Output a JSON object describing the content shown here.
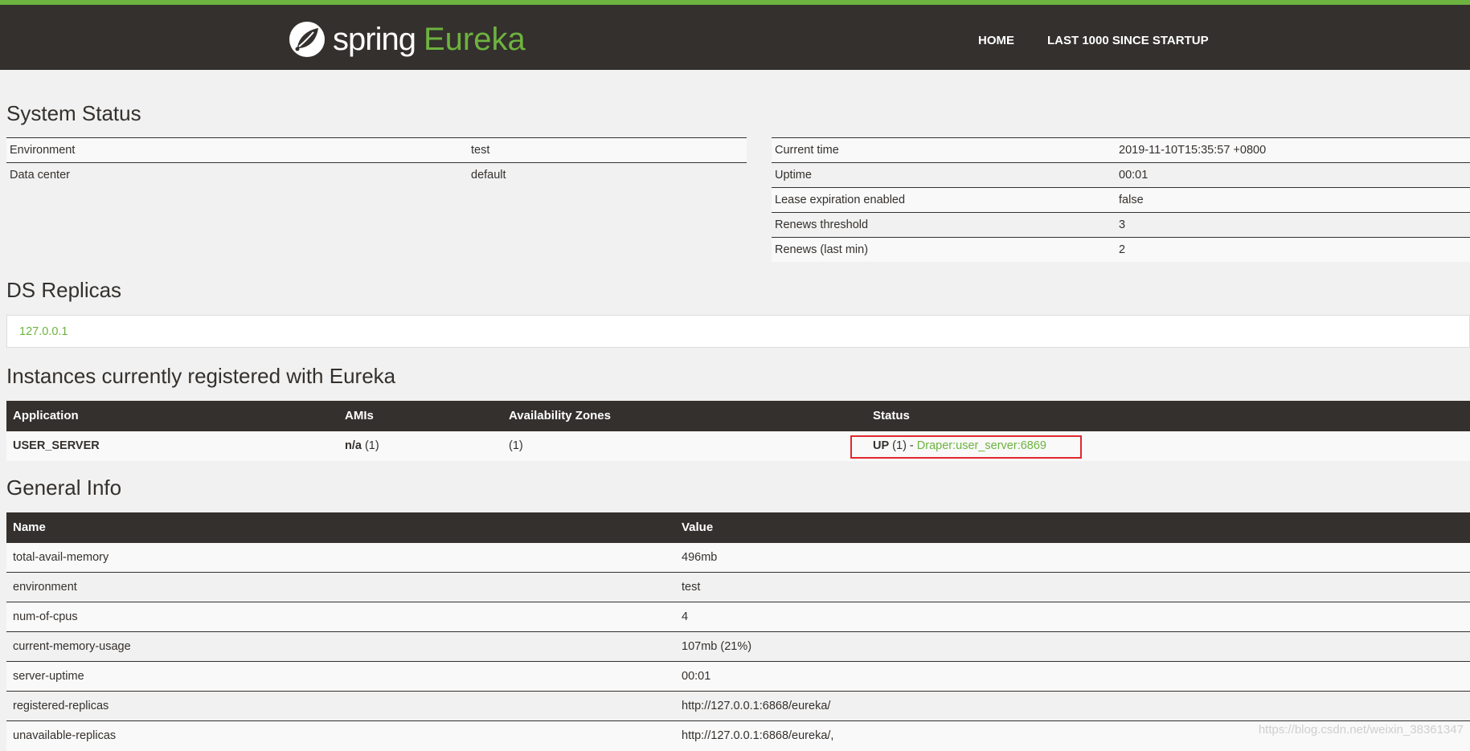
{
  "header": {
    "brand_spring": "spring",
    "brand_eureka": "Eureka",
    "nav": [
      "HOME",
      "LAST 1000 SINCE STARTUP"
    ],
    "colors": {
      "bar": "#34302d",
      "accent": "#6db33f"
    }
  },
  "system_status": {
    "title": "System Status",
    "left": [
      {
        "k": "Environment",
        "v": "test"
      },
      {
        "k": "Data center",
        "v": "default"
      }
    ],
    "right": [
      {
        "k": "Current time",
        "v": "2019-11-10T15:35:57 +0800"
      },
      {
        "k": "Uptime",
        "v": "00:01"
      },
      {
        "k": "Lease expiration enabled",
        "v": "false"
      },
      {
        "k": "Renews threshold",
        "v": "3"
      },
      {
        "k": "Renews (last min)",
        "v": "2"
      }
    ]
  },
  "ds_replicas": {
    "title": "DS Replicas",
    "value": "127.0.0.1"
  },
  "instances": {
    "title": "Instances currently registered with Eureka",
    "headers": [
      "Application",
      "AMIs",
      "Availability Zones",
      "Status"
    ],
    "rows": [
      {
        "application": "USER_SERVER",
        "ami_bold": "n/a",
        "ami_count": " (1)",
        "zones": "(1)",
        "status_bold": "UP",
        "status_count": " (1) - ",
        "status_link": "Draper:user_server:6869"
      }
    ]
  },
  "general_info": {
    "title": "General Info",
    "headers": [
      "Name",
      "Value"
    ],
    "rows": [
      {
        "name": "total-avail-memory",
        "value": "496mb"
      },
      {
        "name": "environment",
        "value": "test"
      },
      {
        "name": "num-of-cpus",
        "value": "4"
      },
      {
        "name": "current-memory-usage",
        "value": "107mb (21%)"
      },
      {
        "name": "server-uptime",
        "value": "00:01"
      },
      {
        "name": "registered-replicas",
        "value": "http://127.0.0.1:6868/eureka/"
      },
      {
        "name": "unavailable-replicas",
        "value": "http://127.0.0.1:6868/eureka/,"
      }
    ]
  },
  "watermark": "https://blog.csdn.net/weixin_38361347"
}
